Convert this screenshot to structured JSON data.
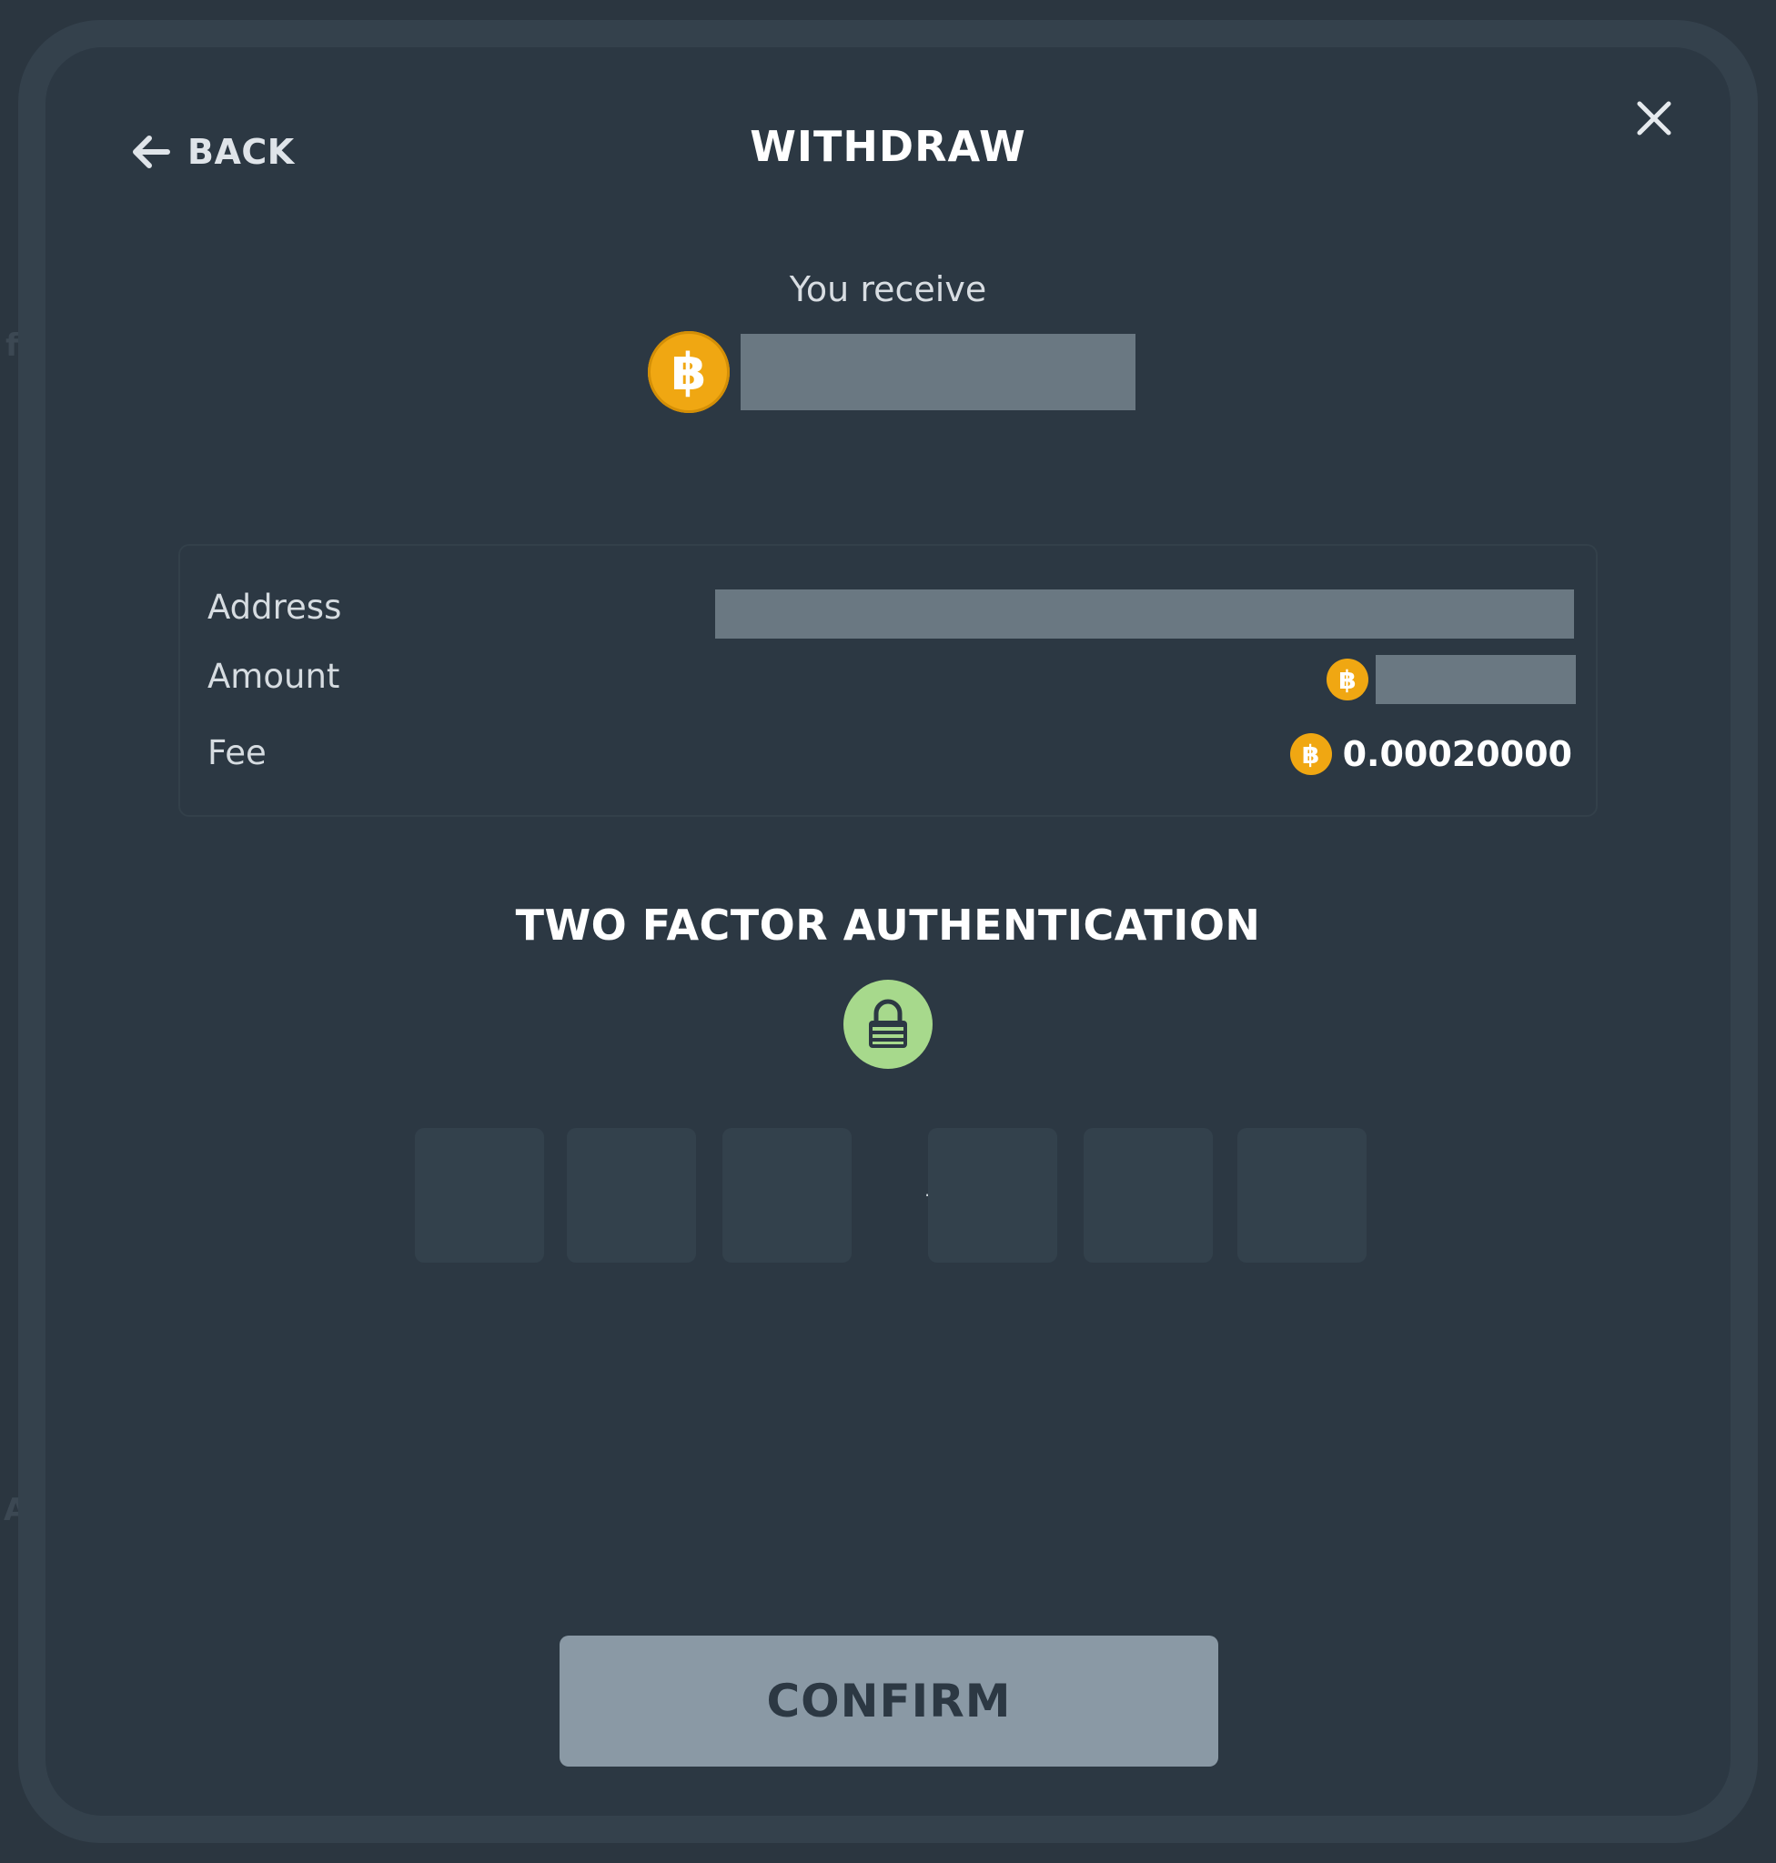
{
  "header": {
    "back_label": "BACK",
    "title": "WITHDRAW"
  },
  "receive": {
    "label": "You receive",
    "coin_symbol": "฿",
    "coin_color": "#f0a712"
  },
  "details": {
    "address_label": "Address",
    "amount_label": "Amount",
    "fee_label": "Fee",
    "fee_value": "0.00020000",
    "coin_symbol": "฿"
  },
  "two_factor": {
    "title": "TWO FACTOR AUTHENTICATION",
    "separator": "–",
    "icon": "lock-icon",
    "icon_color": "#a7d98c"
  },
  "confirm": {
    "label": "CONFIRM"
  },
  "colors": {
    "background": "#2c3843",
    "code_box": "#33414c",
    "confirm_button": "#8a99a5"
  }
}
